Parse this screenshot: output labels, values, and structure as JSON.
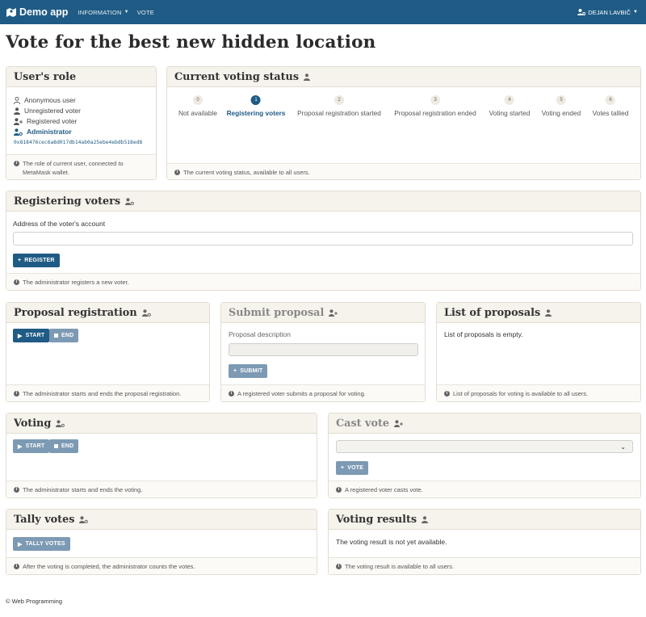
{
  "nav": {
    "brand": "Demo app",
    "information": "INFORMATION",
    "vote": "VOTE",
    "user": "DEJAN LAVBIČ"
  },
  "page_title": "Vote for the best new hidden location",
  "user_role": {
    "title": "User's role",
    "roles": [
      "Anonymous user",
      "Unregistered voter",
      "Registered voter",
      "Administrator"
    ],
    "active_role": "Administrator",
    "address": "0x818476cec6a8d017db14ab0a25ebe4ebdb518ed8",
    "footer": "The role of current user, connected to MetaMask wallet."
  },
  "voting_status": {
    "title": "Current voting status",
    "steps": [
      {
        "num": "0",
        "label": "Not available"
      },
      {
        "num": "1",
        "label": "Registering voters"
      },
      {
        "num": "2",
        "label": "Proposal registration started"
      },
      {
        "num": "3",
        "label": "Proposal registration ended"
      },
      {
        "num": "4",
        "label": "Voting started"
      },
      {
        "num": "5",
        "label": "Voting ended"
      },
      {
        "num": "6",
        "label": "Votes tallied"
      }
    ],
    "active_step": "1",
    "footer": "The current voting status, available to all users."
  },
  "registering": {
    "title": "Registering voters",
    "field_label": "Address of the voter's account",
    "field_value": "",
    "button": "REGISTER",
    "footer": "The administrator registers a new voter."
  },
  "proposal_registration": {
    "title": "Proposal registration",
    "start": "START",
    "end": "END",
    "footer": "The administrator starts and ends the proposal registration."
  },
  "submit_proposal": {
    "title": "Submit proposal",
    "field_label": "Proposal description",
    "field_value": "",
    "button": "SUBMIT",
    "footer": "A registered voter submits a proposal for voting."
  },
  "list_proposals": {
    "title": "List of proposals",
    "empty": "List of proposals is empty.",
    "footer": "List of proposals for voting is available to all users."
  },
  "voting": {
    "title": "Voting",
    "start": "START",
    "end": "END",
    "footer": "The administrator starts and ends the voting."
  },
  "cast_vote": {
    "title": "Cast vote",
    "selected": "",
    "button": "VOTE",
    "footer": "A registered voter casts vote."
  },
  "tally": {
    "title": "Tally votes",
    "button": "TALLY VOTES",
    "footer": "After the voting is completed, the administrator counts the votes."
  },
  "results": {
    "title": "Voting results",
    "text": "The voting result is not yet available.",
    "footer": "The voting result is available to all users."
  },
  "footer": "© Web Programming",
  "colors": {
    "primary": "#1f5b85",
    "muted_button": "#7d9ab4",
    "card_header": "#f6f3ec"
  }
}
